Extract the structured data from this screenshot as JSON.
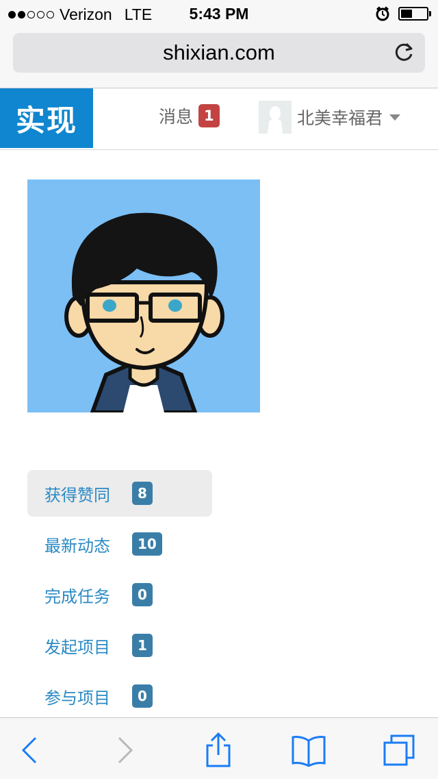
{
  "status_bar": {
    "carrier": "Verizon",
    "network": "LTE",
    "time": "5:43 PM",
    "signal_filled": 2,
    "signal_total": 5,
    "battery_level": 0.4
  },
  "browser": {
    "url": "shixian.com"
  },
  "nav": {
    "brand": "实现",
    "messages_label": "消息",
    "messages_count": "1",
    "username": "北美幸福君"
  },
  "stats": [
    {
      "label": "获得赞同",
      "count": "8"
    },
    {
      "label": "最新动态",
      "count": "10"
    },
    {
      "label": "完成任务",
      "count": "0"
    },
    {
      "label": "发起项目",
      "count": "1"
    },
    {
      "label": "参与项目",
      "count": "0"
    }
  ],
  "colors": {
    "brand": "#0f86cf",
    "link": "#2a8ac4",
    "badge_red": "#c34343",
    "badge_blue": "#3a7ea8",
    "ios_blue": "#1a7cf5"
  },
  "icons": [
    "alarm-icon",
    "battery-icon",
    "reload-icon",
    "back-icon",
    "forward-icon",
    "share-icon",
    "bookmarks-icon",
    "tabs-icon",
    "caret-down-icon"
  ]
}
